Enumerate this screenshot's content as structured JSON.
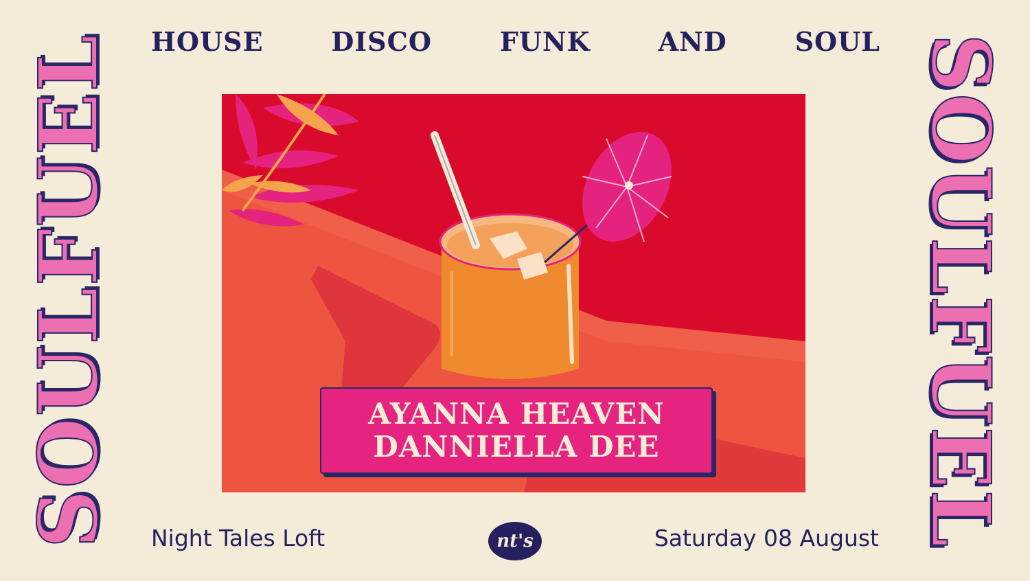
{
  "brand": {
    "side_title": "SOULFUEL",
    "logo_text": "nt's"
  },
  "genres": [
    "HOUSE",
    "DISCO",
    "FUNK",
    "AND",
    "SOUL"
  ],
  "lineup": [
    "ayanna heaven",
    "danniella dee"
  ],
  "venue": "Night Tales Loft",
  "date": "Saturday 08 August",
  "colors": {
    "background": "#f4ecd8",
    "navy": "#26205e",
    "pink": "#ec6fb2",
    "magenta": "#e6237e",
    "red": "#d90a2c",
    "orange": "#f08a2e"
  },
  "artwork": {
    "subject": "cocktail-with-umbrella-illustration"
  }
}
